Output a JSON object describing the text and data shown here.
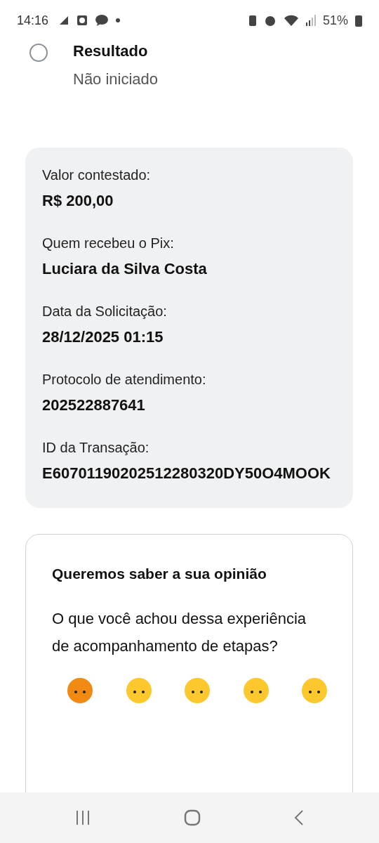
{
  "status_bar": {
    "time": "14:16",
    "battery": "51%"
  },
  "step": {
    "title": "Resultado",
    "status": "Não iniciado",
    "done": false
  },
  "details": [
    {
      "label": "Valor contestado:",
      "value": "R$ 200,00"
    },
    {
      "label": "Quem recebeu o Pix:",
      "value": "Luciara da Silva Costa"
    },
    {
      "label": "Data da Solicitação:",
      "value": "28/12/2025 01:15"
    },
    {
      "label": "Protocolo de atendimento:",
      "value": "202522887641"
    },
    {
      "label": "ID da Transação:",
      "value": "E60701190202512280320DY50O4MOOK"
    }
  ],
  "feedback": {
    "title": "Queremos saber a sua opinião",
    "question": "O que você achou dessa experiência de acompanhamento de etapas?",
    "ratings": [
      {
        "color": "#f08a12"
      },
      {
        "color": "#fcc82e"
      },
      {
        "color": "#fcc82e"
      },
      {
        "color": "#fcc82e"
      },
      {
        "color": "#fcc82e"
      }
    ]
  }
}
